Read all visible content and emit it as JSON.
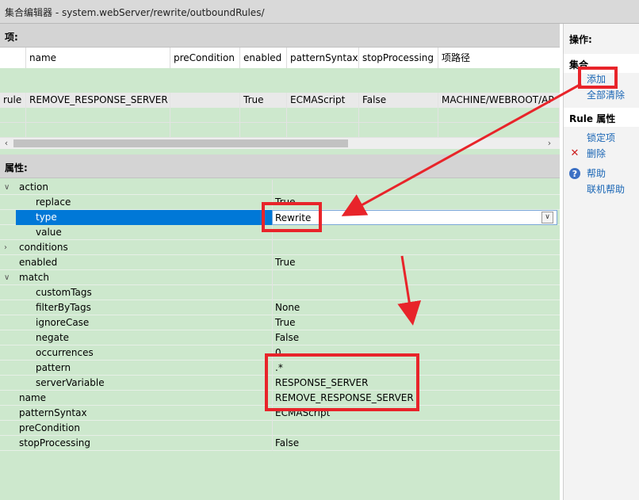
{
  "window": {
    "title": "集合编辑器 - system.webServer/rewrite/outboundRules/"
  },
  "items": {
    "header": "项:",
    "columns": [
      "",
      "name",
      "preCondition",
      "enabled",
      "patternSyntax",
      "stopProcessing",
      "项路径"
    ],
    "rows": [
      [
        "rule",
        "REMOVE_RESPONSE_SERVER",
        "",
        "True",
        "ECMAScript",
        "False",
        "MACHINE/WEBROOT/AP"
      ]
    ]
  },
  "properties": {
    "header": "属性:",
    "rows": [
      {
        "name": "action",
        "value": "",
        "toggle": "∨"
      },
      {
        "name": "replace",
        "value": "True",
        "toggle": ""
      },
      {
        "name": "type",
        "value": "Rewrite",
        "toggle": ""
      },
      {
        "name": "value",
        "value": "",
        "toggle": ""
      },
      {
        "name": "conditions",
        "value": "",
        "toggle": "›"
      },
      {
        "name": "enabled",
        "value": "True",
        "toggle": ""
      },
      {
        "name": "match",
        "value": "",
        "toggle": "∨"
      },
      {
        "name": "customTags",
        "value": "",
        "toggle": ""
      },
      {
        "name": "filterByTags",
        "value": "None",
        "toggle": ""
      },
      {
        "name": "ignoreCase",
        "value": "True",
        "toggle": ""
      },
      {
        "name": "negate",
        "value": "False",
        "toggle": ""
      },
      {
        "name": "occurrences",
        "value": "0",
        "toggle": ""
      },
      {
        "name": "pattern",
        "value": ".*",
        "toggle": ""
      },
      {
        "name": "serverVariable",
        "value": "RESPONSE_SERVER",
        "toggle": ""
      },
      {
        "name": "name",
        "value": "REMOVE_RESPONSE_SERVER",
        "toggle": ""
      },
      {
        "name": "patternSyntax",
        "value": "ECMAScript",
        "toggle": ""
      },
      {
        "name": "preCondition",
        "value": "",
        "toggle": ""
      },
      {
        "name": "stopProcessing",
        "value": "False",
        "toggle": ""
      }
    ]
  },
  "actions": {
    "header": "操作:",
    "collection_header": "集合",
    "add": "添加",
    "clear_all": "全部清除",
    "rule_header": "Rule 属性",
    "lock": "锁定项",
    "delete": "删除",
    "help": "帮助",
    "online_help": "联机帮助"
  },
  "colors": {
    "highlight": "#e8242a",
    "selection": "#0078d7",
    "panel_green": "#cde8cd"
  }
}
